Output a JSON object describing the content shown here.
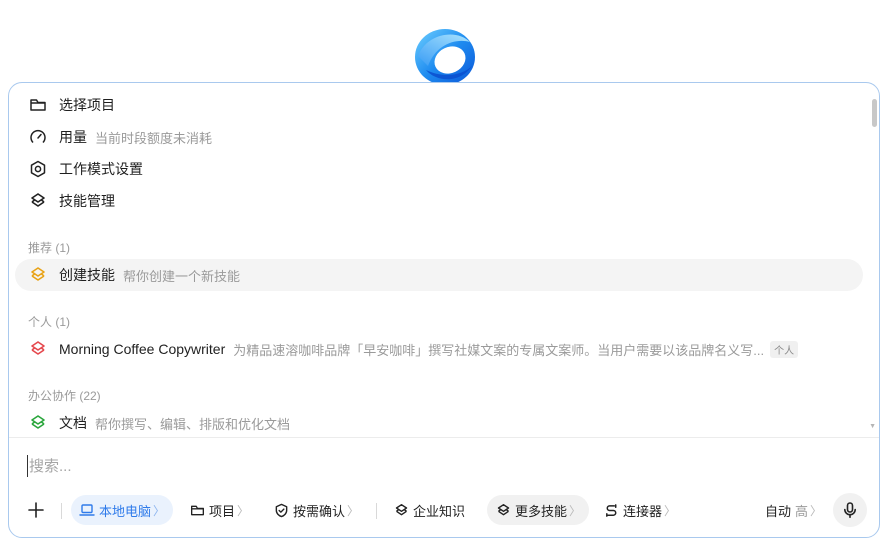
{
  "menu": {
    "items": [
      {
        "label": "选择项目",
        "icon": "folder-icon"
      },
      {
        "label": "用量",
        "desc": "当前时段额度未消耗",
        "icon": "gauge-icon"
      },
      {
        "label": "工作模式设置",
        "icon": "gear-icon"
      },
      {
        "label": "技能管理",
        "icon": "layers-icon"
      }
    ],
    "sections": [
      {
        "title": "推荐 (1)",
        "skills": [
          {
            "label": "创建技能",
            "desc": "帮你创建一个新技能",
            "color": "#e8a317",
            "highlighted": true
          }
        ]
      },
      {
        "title": "个人 (1)",
        "skills": [
          {
            "label": "Morning Coffee Copywriter",
            "desc": "为精品速溶咖啡品牌「早安咖啡」撰写社媒文案的专属文案师。当用户需要以该品牌名义写...",
            "tag": "个人",
            "color": "#e5484d"
          }
        ]
      },
      {
        "title": "办公协作 (22)",
        "skills": [
          {
            "label": "文档",
            "desc": "帮你撰写、编辑、排版和优化文档",
            "color": "#2aa63c"
          }
        ]
      }
    ]
  },
  "search": {
    "placeholder": "搜索..."
  },
  "toolbar": {
    "add_icon": "plus-icon",
    "local": "本地电脑",
    "project": "项目",
    "confirm": "按需确认",
    "knowledge": "企业知识",
    "more_skills": "更多技能",
    "connector": "连接器",
    "auto": "自动",
    "level": "高",
    "chevron": "〉"
  },
  "colors": {
    "accent": "#2f7bea",
    "border": "#a9c9ee"
  }
}
